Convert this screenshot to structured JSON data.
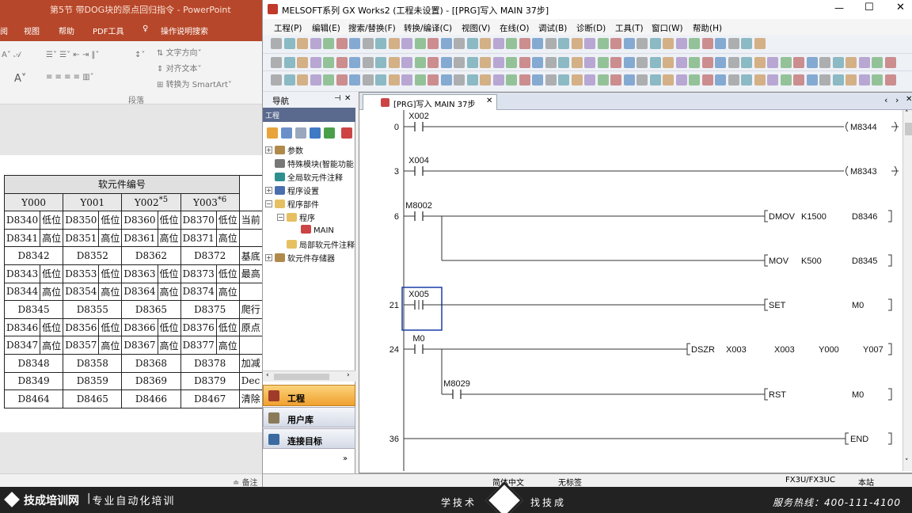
{
  "ppt": {
    "title": "第5节 带DOG块的原点回归指令 - PowerPoint",
    "tabs": [
      "阅",
      "视图",
      "帮助",
      "PDF工具",
      "操作说明搜索"
    ],
    "ribbon": {
      "text_direction": "文字方向",
      "align_text": "对齐文本",
      "convert_smartart": "转换为 SmartArt",
      "group_label": "段落"
    },
    "status_notes": "备注",
    "table": {
      "header": "软元件编号",
      "columns": [
        "Y000",
        "Y001",
        "Y002",
        "Y003"
      ],
      "column_sups": [
        "",
        "",
        "*5",
        "*6"
      ],
      "rows": [
        [
          "D8340",
          "低位",
          "D8350",
          "低位",
          "D8360",
          "低位",
          "D8370",
          "低位",
          "当前"
        ],
        [
          "D8341",
          "高位",
          "D8351",
          "高位",
          "D8361",
          "高位",
          "D8371",
          "高位",
          ""
        ],
        [
          "D8342",
          "",
          "D8352",
          "",
          "D8362",
          "",
          "D8372",
          "",
          "基底"
        ],
        [
          "D8343",
          "低位",
          "D8353",
          "低位",
          "D8363",
          "低位",
          "D8373",
          "低位",
          "最高"
        ],
        [
          "D8344",
          "高位",
          "D8354",
          "高位",
          "D8364",
          "高位",
          "D8374",
          "高位",
          ""
        ],
        [
          "D8345",
          "",
          "D8355",
          "",
          "D8365",
          "",
          "D8375",
          "",
          "爬行"
        ],
        [
          "D8346",
          "低位",
          "D8356",
          "低位",
          "D8366",
          "低位",
          "D8376",
          "低位",
          "原点"
        ],
        [
          "D8347",
          "高位",
          "D8357",
          "高位",
          "D8367",
          "高位",
          "D8377",
          "高位",
          ""
        ],
        [
          "D8348",
          "",
          "D8358",
          "",
          "D8368",
          "",
          "D8378",
          "",
          "加减"
        ],
        [
          "D8349",
          "",
          "D8359",
          "",
          "D8369",
          "",
          "D8379",
          "",
          "Dec"
        ],
        [
          "D8464",
          "",
          "D8465",
          "",
          "D8466",
          "",
          "D8467",
          "",
          "清除"
        ]
      ]
    }
  },
  "gx": {
    "title": "MELSOFT系列 GX Works2 (工程未设置) - [[PRG]写入 MAIN 37步]",
    "menu": [
      "工程(P)",
      "编辑(E)",
      "搜索/替换(F)",
      "转换/编译(C)",
      "视图(V)",
      "在线(O)",
      "调试(B)",
      "诊断(D)",
      "工具(T)",
      "窗口(W)",
      "帮助(H)"
    ],
    "nav": {
      "title": "导航",
      "project_label": "工程",
      "tree": [
        "参数",
        "特殊模块(智能功能",
        "全局软元件注释",
        "程序设置",
        "程序部件",
        "程序",
        "MAIN",
        "局部软元件注释",
        "软元件存储器"
      ],
      "buttons": [
        "工程",
        "用户库",
        "连接目标"
      ]
    },
    "editor_tab": "[PRG]写入 MAIN 37步",
    "ladder": [
      {
        "step": "0",
        "contacts": [
          "X002"
        ],
        "instr": "M8344",
        "kind": "coil"
      },
      {
        "step": "3",
        "contacts": [
          "X004"
        ],
        "instr": "M8343",
        "kind": "coil"
      },
      {
        "step": "6",
        "contacts": [
          "M8002"
        ],
        "instr": "DMOV",
        "args": [
          "K1500",
          "D8346"
        ],
        "kind": "func"
      },
      {
        "step": "",
        "contacts": [],
        "instr": "MOV",
        "args": [
          "K500",
          "D8345"
        ],
        "kind": "func"
      },
      {
        "step": "21",
        "contacts": [
          "X005"
        ],
        "instr": "SET",
        "args": [
          "M0"
        ],
        "kind": "func"
      },
      {
        "step": "24",
        "contacts": [
          "M0"
        ],
        "instr": "DSZR",
        "args": [
          "X003",
          "X003",
          "Y000",
          "Y007"
        ],
        "kind": "func"
      },
      {
        "step": "",
        "contacts": [
          "M8029"
        ],
        "instr": "RST",
        "args": [
          "M0"
        ],
        "kind": "func"
      },
      {
        "step": "36",
        "contacts": [],
        "instr": "END",
        "kind": "end"
      }
    ],
    "status": {
      "lang": "简体中文",
      "label": "无标签",
      "plc": "FX3U/FX3UC",
      "station": "本站"
    }
  },
  "banner": {
    "brand": "技成培训网",
    "slogan": "专业自动化培训",
    "center_left": "学技术",
    "center_right": "找技成",
    "hotline": "服务热线：400-111-4100"
  }
}
